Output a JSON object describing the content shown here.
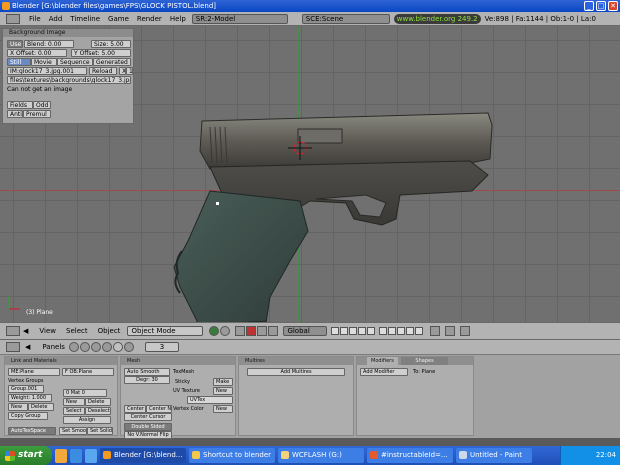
{
  "window": {
    "title": "Blender [G:\\blender files\\games\\FPS\\GLOCK PISTOL.blend]",
    "min_glyph": "_",
    "max_glyph": "□",
    "close_glyph": "✕"
  },
  "header": {
    "menus": [
      "File",
      "Add",
      "Timeline",
      "Game",
      "Render",
      "Help"
    ],
    "screen": "SR:2-Model",
    "scene": "SCE:Scene",
    "website": "www.blender.org 249.2",
    "stats": "Ve:898 | Fa:1144 | Ob:1-0 | La:0"
  },
  "background_panel": {
    "title": "Background Image",
    "use": "Use",
    "blend": "Blend: 0.00",
    "size": "Size: 5.00",
    "x_offset": "X Offset: 0.00",
    "y_offset": "Y Offset: 5.00",
    "tabs": [
      "Still",
      "Movie",
      "Sequence",
      "Generated"
    ],
    "image_name": "IM:glock17_3.jpg.001",
    "reload": "Reload",
    "x": "X",
    "users": "1",
    "path": "files\\textures\\backgrounds\\glock17_3.jpg",
    "error": "Can not get an image",
    "fields": "Fields",
    "odd": "Odd",
    "anti": "Anti",
    "premul": "Premul"
  },
  "viewport": {
    "object_label": "(3) Plane"
  },
  "view_header": {
    "menus": [
      "View",
      "Select",
      "Object"
    ],
    "mode": "Object Mode",
    "orientation": "Global"
  },
  "buttons_window": {
    "panels_label": "Panels",
    "frame": "3",
    "link_panel": {
      "title": "Link and Materials",
      "me": "ME:Plane",
      "ob": "F OB:Plane",
      "vertex_groups": "Vertex Groups",
      "group": "Group.001",
      "weight": "Weight: 1.000",
      "mat": "0 Mat 0",
      "new": "New",
      "delete": "Delete",
      "copy_group": "Copy Group",
      "select": "Select",
      "deselect": "Deselect",
      "assign": "Assign",
      "autotexspace": "AutoTexSpace",
      "set_smooth": "Set Smooth",
      "set_solid": "Set Solid"
    },
    "mesh_panel": {
      "title": "Mesh",
      "auto_smooth": "Auto Smooth",
      "degr": "Degr: 30",
      "sticky": "Sticky",
      "make": "Make",
      "uv_texture": "UV Texture",
      "new": "New",
      "uvtex": "UVTex",
      "vertex_color": "Vertex Color",
      "texmesh": "TexMesh",
      "center": "Center",
      "center_new": "Center New",
      "center_cursor": "Center Cursor",
      "double_sided": "Double Sided",
      "no_v_normal_flip": "No V.Normal Flip"
    },
    "multires_panel": {
      "title": "Multires",
      "add": "Add Multires"
    },
    "modifiers_panel": {
      "tab_modifiers": "Modifiers",
      "tab_shapes": "Shapes",
      "add": "Add Modifier",
      "to": "To: Plane"
    }
  },
  "taskbar": {
    "start": "start",
    "tasks": [
      {
        "label": "Blender [G:\\blend...",
        "color": "#f49a1f"
      },
      {
        "label": "Shortcut to blender",
        "color": "#f4c84a"
      },
      {
        "label": "WCFLASH (G:)",
        "color": "#f4d27a"
      },
      {
        "label": "#instructableId=...",
        "color": "#e55a2a"
      },
      {
        "label": "Untitled - Paint",
        "color": "#cfd8e8"
      }
    ],
    "clock": "22:04"
  }
}
